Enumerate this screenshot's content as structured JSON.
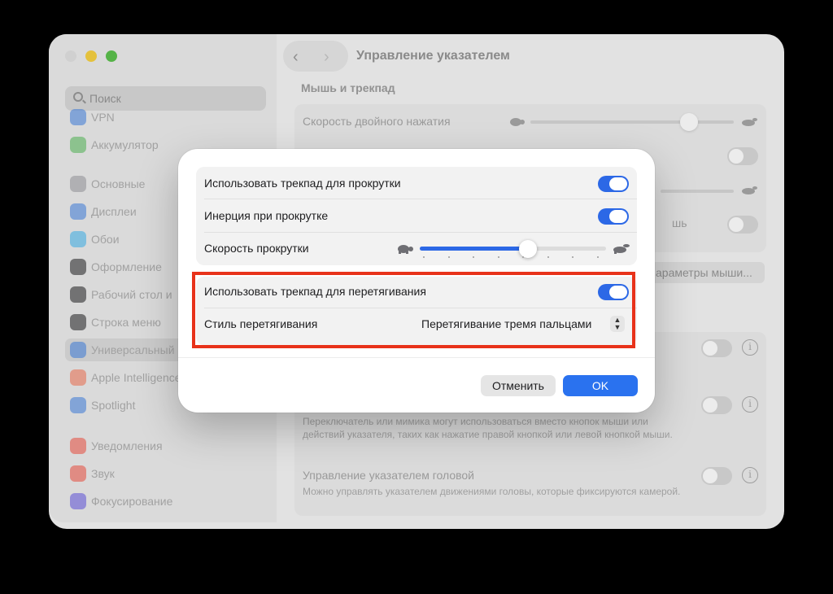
{
  "window": {
    "title": "Управление указателем",
    "nav": {
      "back": "‹",
      "forward": "›"
    }
  },
  "sidebar": {
    "search_placeholder": "Поиск",
    "items": [
      {
        "label": "VPN",
        "icon": "vpn-icon",
        "color": "#3a78d6"
      },
      {
        "label": "Аккумулятор",
        "icon": "battery-icon",
        "color": "#4caf50"
      },
      {
        "label": "Основные",
        "icon": "gear-icon",
        "color": "#8e8e93"
      },
      {
        "label": "Дисплеи",
        "icon": "display-icon",
        "color": "#3a78d6"
      },
      {
        "label": "Обои",
        "icon": "wallpaper-icon",
        "color": "#36a9e1"
      },
      {
        "label": "Оформление",
        "icon": "appearance-icon",
        "color": "#1d1d1f"
      },
      {
        "label": "Рабочий стол и",
        "icon": "desktop-icon",
        "color": "#1d1d1f"
      },
      {
        "label": "Строка меню",
        "icon": "menubar-icon",
        "color": "#1d1d1f"
      },
      {
        "label": "Универсальный",
        "icon": "accessibility-icon",
        "color": "#3a78d6"
      },
      {
        "label": "Apple Intelligence",
        "icon": "apple-intelligence-icon",
        "color": "#e86a4a"
      },
      {
        "label": "Spotlight",
        "icon": "spotlight-icon",
        "color": "#3a78d6"
      },
      {
        "label": "Уведомления",
        "icon": "notifications-icon",
        "color": "#e64a3c"
      },
      {
        "label": "Звук",
        "icon": "sound-icon",
        "color": "#e64a3c"
      },
      {
        "label": "Фокусирование",
        "icon": "focus-icon",
        "color": "#5b4fd6"
      }
    ]
  },
  "main": {
    "section_title": "Мышь и трекпад",
    "double_click_label": "Скорость двойного нажатия",
    "partial_label": "шь",
    "mouse_options_button": "араметры мыши...",
    "switch_desc": "Переключатель или мимика могут использоваться вместо кнопок мыши или действий указателя, таких как нажатие правой кнопкой или левой кнопкой мыши.",
    "head_pointer_label": "Управление указателем головой",
    "head_pointer_desc": "Можно управлять указателем движениями головы, которые фиксируются камерой."
  },
  "dialog": {
    "scroll_label": "Использовать трекпад для прокрутки",
    "scroll_on": true,
    "inertia_label": "Инерция при прокрутке",
    "inertia_on": true,
    "scroll_speed_label": "Скорость прокрутки",
    "scroll_speed_value": 0.58,
    "drag_label": "Использовать трекпад для перетягивания",
    "drag_on": true,
    "drag_style_label": "Стиль перетягивания",
    "drag_style_value": "Перетягивание тремя пальцами",
    "cancel": "Отменить",
    "ok": "OK"
  },
  "colors": {
    "accent": "#2c68e6",
    "highlight": "#e8321a"
  }
}
